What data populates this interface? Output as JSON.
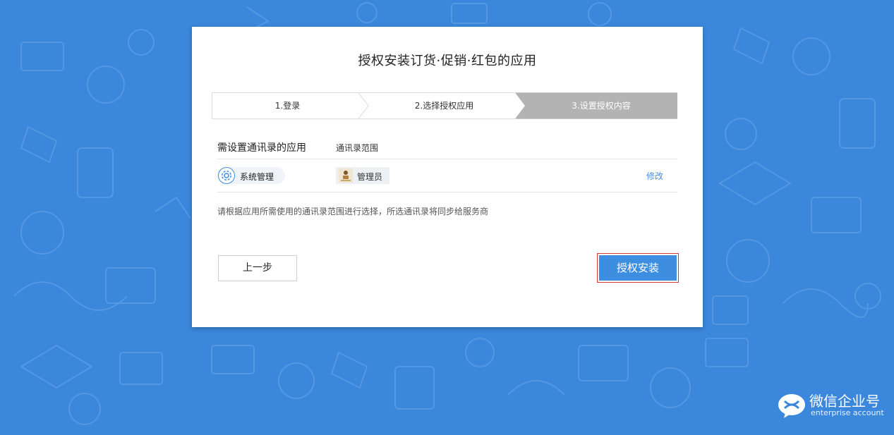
{
  "dialog": {
    "title": "授权安装订货·促销·红包的应用"
  },
  "steps": [
    {
      "label": "1.登录",
      "active": false
    },
    {
      "label": "2.选择授权应用",
      "active": false
    },
    {
      "label": "3.设置授权内容",
      "active": true
    }
  ],
  "section": {
    "heading": "需设置通讯录的应用",
    "scope_heading": "通讯录范围"
  },
  "app_row": {
    "app_name": "系统管理",
    "app_icon": "gear-icon",
    "scope_name": "管理员",
    "modify_label": "修改"
  },
  "hint": "请根据应用所需使用的通讯录范围进行选择，所选通讯录将同步给服务商",
  "buttons": {
    "prev_label": "上一步",
    "install_label": "授权安装"
  },
  "brand": {
    "title": "微信企业号",
    "subtitle": "enterprise account"
  },
  "colors": {
    "background": "#3a87dc",
    "accent": "#3d8de0",
    "active_step": "#b3b3b3",
    "link": "#4a8fe0",
    "focus_outline": "#d43c3c"
  }
}
